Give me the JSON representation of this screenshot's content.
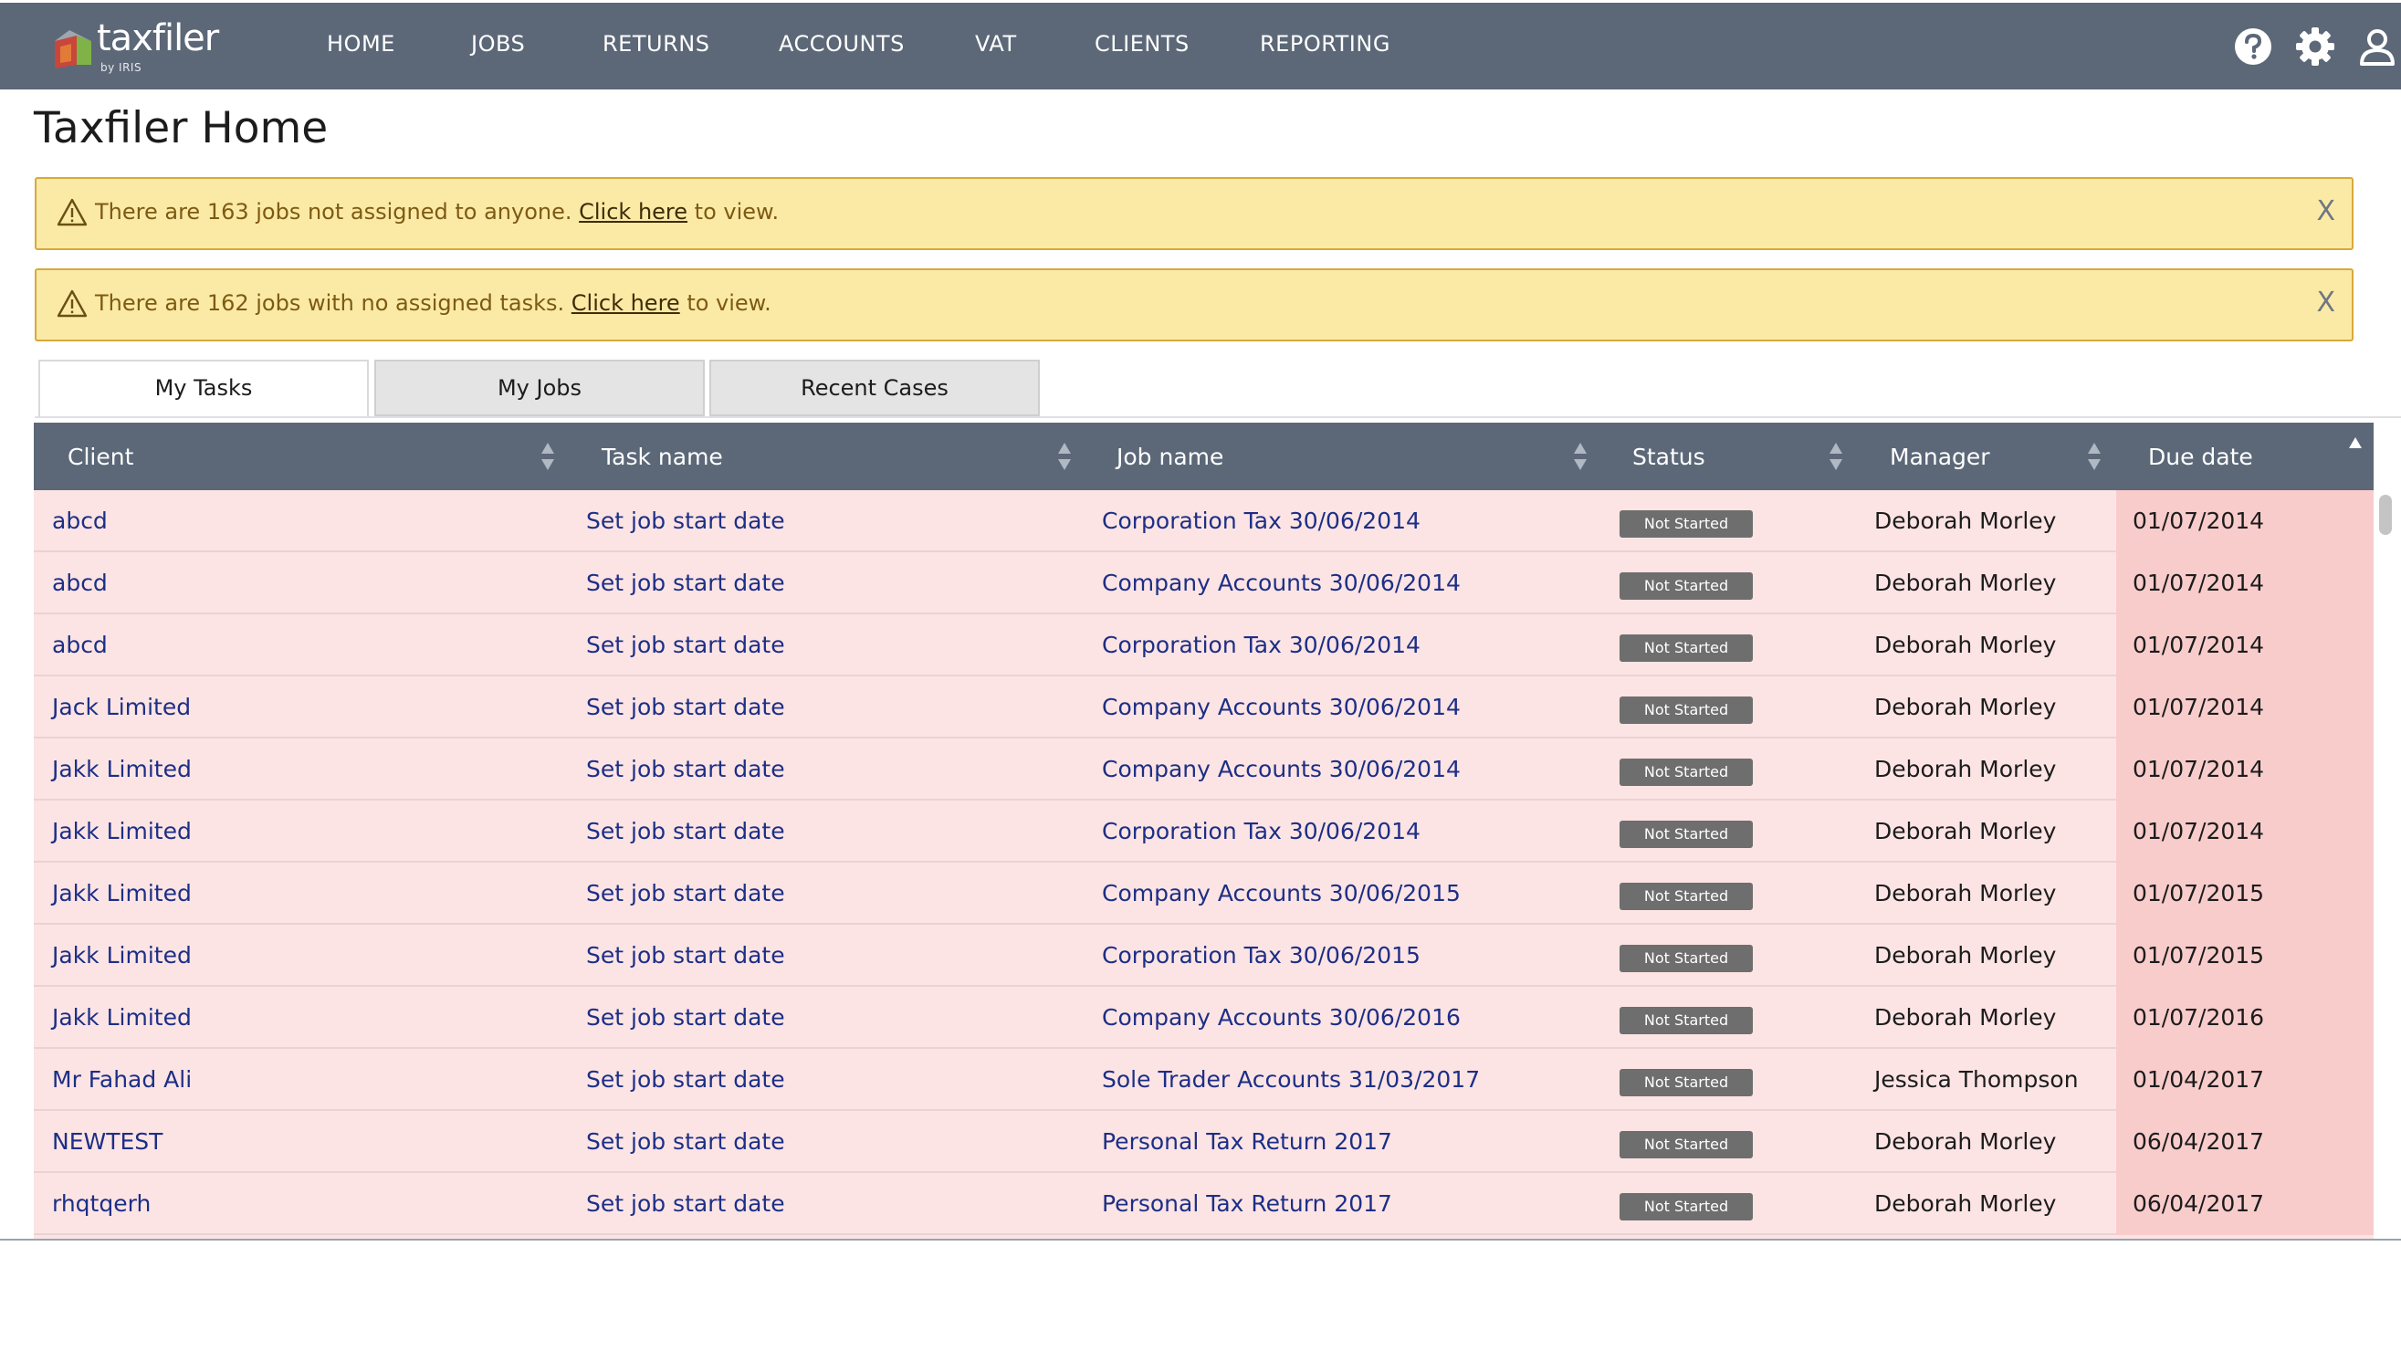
{
  "brand": {
    "name": "taxfiler",
    "sub": "by IRIS"
  },
  "nav": {
    "items": [
      {
        "key": "home",
        "label": "HOME"
      },
      {
        "key": "jobs",
        "label": "JOBS"
      },
      {
        "key": "returns",
        "label": "RETURNS"
      },
      {
        "key": "accounts",
        "label": "ACCOUNTS"
      },
      {
        "key": "vat",
        "label": "VAT"
      },
      {
        "key": "clients",
        "label": "CLIENTS"
      },
      {
        "key": "reporting",
        "label": "REPORTING"
      }
    ],
    "icons": [
      "help-icon",
      "gear-icon",
      "user-icon"
    ]
  },
  "page": {
    "title": "Taxfiler Home"
  },
  "alerts": [
    {
      "prefix": "There are 163 jobs not assigned to anyone. ",
      "link": "Click here",
      "suffix": " to view.",
      "close": "X"
    },
    {
      "prefix": "There are 162 jobs with no assigned tasks. ",
      "link": "Click here",
      "suffix": " to view.",
      "close": "X"
    }
  ],
  "tabs": [
    {
      "label": "My Tasks",
      "active": true
    },
    {
      "label": "My Jobs",
      "active": false
    },
    {
      "label": "Recent Cases",
      "active": false
    }
  ],
  "table": {
    "columns": [
      "Client",
      "Task name",
      "Job name",
      "Status",
      "Manager",
      "Due date"
    ],
    "rows": [
      {
        "client": "abcd",
        "task": "Set job start date",
        "job": "Corporation Tax 30/06/2014",
        "status": "Not Started",
        "manager": "Deborah Morley",
        "due": "01/07/2014"
      },
      {
        "client": "abcd",
        "task": "Set job start date",
        "job": "Company Accounts 30/06/2014",
        "status": "Not Started",
        "manager": "Deborah Morley",
        "due": "01/07/2014"
      },
      {
        "client": "abcd",
        "task": "Set job start date",
        "job": "Corporation Tax 30/06/2014",
        "status": "Not Started",
        "manager": "Deborah Morley",
        "due": "01/07/2014"
      },
      {
        "client": "Jack Limited",
        "task": "Set job start date",
        "job": "Company Accounts 30/06/2014",
        "status": "Not Started",
        "manager": "Deborah Morley",
        "due": "01/07/2014"
      },
      {
        "client": "Jakk Limited",
        "task": "Set job start date",
        "job": "Company Accounts 30/06/2014",
        "status": "Not Started",
        "manager": "Deborah Morley",
        "due": "01/07/2014"
      },
      {
        "client": "Jakk Limited",
        "task": "Set job start date",
        "job": "Corporation Tax 30/06/2014",
        "status": "Not Started",
        "manager": "Deborah Morley",
        "due": "01/07/2014"
      },
      {
        "client": "Jakk Limited",
        "task": "Set job start date",
        "job": "Company Accounts 30/06/2015",
        "status": "Not Started",
        "manager": "Deborah Morley",
        "due": "01/07/2015"
      },
      {
        "client": "Jakk Limited",
        "task": "Set job start date",
        "job": "Corporation Tax 30/06/2015",
        "status": "Not Started",
        "manager": "Deborah Morley",
        "due": "01/07/2015"
      },
      {
        "client": "Jakk Limited",
        "task": "Set job start date",
        "job": "Company Accounts 30/06/2016",
        "status": "Not Started",
        "manager": "Deborah Morley",
        "due": "01/07/2016"
      },
      {
        "client": "Mr Fahad Ali",
        "task": "Set job start date",
        "job": "Sole Trader Accounts 31/03/2017",
        "status": "Not Started",
        "manager": "Jessica Thompson",
        "due": "01/04/2017"
      },
      {
        "client": "NEWTEST",
        "task": "Set job start date",
        "job": "Personal Tax Return 2017",
        "status": "Not Started",
        "manager": "Deborah Morley",
        "due": "06/04/2017"
      },
      {
        "client": "rhqtqerh",
        "task": "Set job start date",
        "job": "Personal Tax Return 2017",
        "status": "Not Started",
        "manager": "Deborah Morley",
        "due": "06/04/2017"
      }
    ]
  },
  "colors": {
    "navbar": "#5c6878",
    "alert_bg": "#fbeaa6",
    "alert_border": "#d8a93a",
    "row_bg": "#fde4e4",
    "due_bg": "#f9cccc",
    "link": "#1c2f86",
    "badge": "#6e6e6e"
  }
}
